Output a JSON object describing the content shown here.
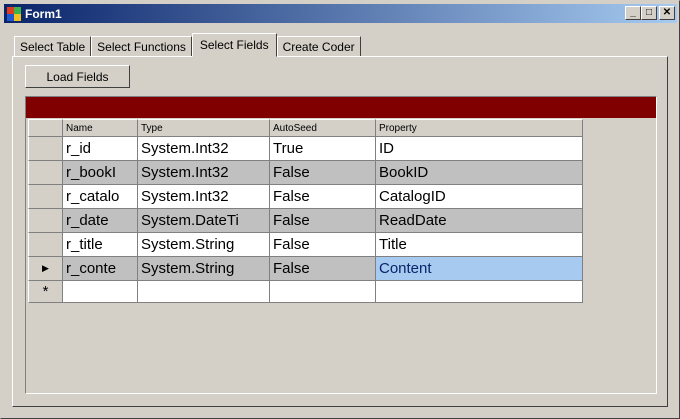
{
  "window": {
    "title": "Form1"
  },
  "controls": {
    "minimize": "_",
    "maximize": "□",
    "close": "✕"
  },
  "tabs": [
    {
      "label": "Select Table"
    },
    {
      "label": "Select Functions"
    },
    {
      "label": "Select Fields",
      "active": true
    },
    {
      "label": "Create Coder"
    }
  ],
  "load_button": {
    "label": "Load Fields"
  },
  "grid": {
    "headers": [
      "Name",
      "Type",
      "AutoSeed",
      "Property"
    ],
    "rows": [
      {
        "name": "r_id",
        "type": "System.Int32",
        "autoseed": "True",
        "property": "ID"
      },
      {
        "name": "r_bookI",
        "type": "System.Int32",
        "autoseed": "False",
        "property": "BookID"
      },
      {
        "name": "r_catalo",
        "type": "System.Int32",
        "autoseed": "False",
        "property": "CatalogID"
      },
      {
        "name": "r_date",
        "type": "System.DateTi",
        "autoseed": "False",
        "property": "ReadDate"
      },
      {
        "name": "r_title",
        "type": "System.String",
        "autoseed": "False",
        "property": "Title"
      },
      {
        "name": "r_conte",
        "type": "System.String",
        "autoseed": "False",
        "property": "Content"
      }
    ],
    "new_row_marker": "*",
    "current_row_marker": "▶",
    "colors": {
      "caption": "#800000",
      "alt_row": "#c0c0c0",
      "selection": "#a6caf0"
    }
  }
}
